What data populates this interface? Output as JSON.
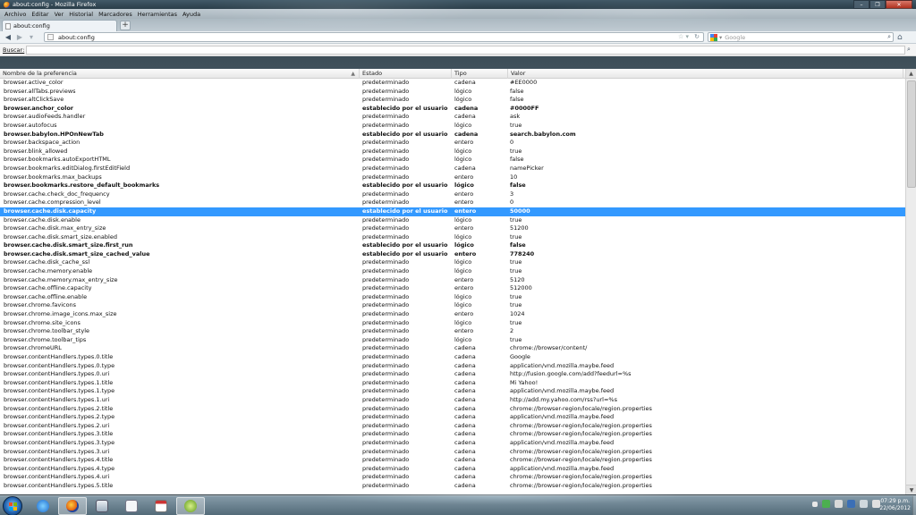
{
  "window": {
    "title": "about:config - Mozilla Firefox"
  },
  "menu": [
    "Archivo",
    "Editar",
    "Ver",
    "Historial",
    "Marcadores",
    "Herramientas",
    "Ayuda"
  ],
  "tab": {
    "label": "about:config"
  },
  "nav": {
    "url": "about:config",
    "search_placeholder": "Google"
  },
  "filter": {
    "label": "Buscar:",
    "value": ""
  },
  "columns": {
    "name": "Nombre de la preferencia",
    "status": "Estado",
    "type": "Tipo",
    "value": "Valor"
  },
  "rows": [
    {
      "name": "browser.active_color",
      "status": "predeterminado",
      "type": "cadena",
      "value": "#EE0000"
    },
    {
      "name": "browser.allTabs.previews",
      "status": "predeterminado",
      "type": "lógico",
      "value": "false"
    },
    {
      "name": "browser.altClickSave",
      "status": "predeterminado",
      "type": "lógico",
      "value": "false"
    },
    {
      "name": "browser.anchor_color",
      "status": "establecido por el usuario",
      "type": "cadena",
      "value": "#0000FF",
      "bold": true
    },
    {
      "name": "browser.audioFeeds.handler",
      "status": "predeterminado",
      "type": "cadena",
      "value": "ask"
    },
    {
      "name": "browser.autofocus",
      "status": "predeterminado",
      "type": "lógico",
      "value": "true"
    },
    {
      "name": "browser.babylon.HPOnNewTab",
      "status": "establecido por el usuario",
      "type": "cadena",
      "value": "search.babylon.com",
      "bold": true
    },
    {
      "name": "browser.backspace_action",
      "status": "predeterminado",
      "type": "entero",
      "value": "0"
    },
    {
      "name": "browser.blink_allowed",
      "status": "predeterminado",
      "type": "lógico",
      "value": "true"
    },
    {
      "name": "browser.bookmarks.autoExportHTML",
      "status": "predeterminado",
      "type": "lógico",
      "value": "false"
    },
    {
      "name": "browser.bookmarks.editDialog.firstEditField",
      "status": "predeterminado",
      "type": "cadena",
      "value": "namePicker"
    },
    {
      "name": "browser.bookmarks.max_backups",
      "status": "predeterminado",
      "type": "entero",
      "value": "10"
    },
    {
      "name": "browser.bookmarks.restore_default_bookmarks",
      "status": "establecido por el usuario",
      "type": "lógico",
      "value": "false",
      "bold": true
    },
    {
      "name": "browser.cache.check_doc_frequency",
      "status": "predeterminado",
      "type": "entero",
      "value": "3"
    },
    {
      "name": "browser.cache.compression_level",
      "status": "predeterminado",
      "type": "entero",
      "value": "0"
    },
    {
      "name": "browser.cache.disk.capacity",
      "status": "establecido por el usuario",
      "type": "entero",
      "value": "50000",
      "bold": true,
      "selected": true
    },
    {
      "name": "browser.cache.disk.enable",
      "status": "predeterminado",
      "type": "lógico",
      "value": "true"
    },
    {
      "name": "browser.cache.disk.max_entry_size",
      "status": "predeterminado",
      "type": "entero",
      "value": "51200"
    },
    {
      "name": "browser.cache.disk.smart_size.enabled",
      "status": "predeterminado",
      "type": "lógico",
      "value": "true"
    },
    {
      "name": "browser.cache.disk.smart_size.first_run",
      "status": "establecido por el usuario",
      "type": "lógico",
      "value": "false",
      "bold": true
    },
    {
      "name": "browser.cache.disk.smart_size_cached_value",
      "status": "establecido por el usuario",
      "type": "entero",
      "value": "778240",
      "bold": true
    },
    {
      "name": "browser.cache.disk_cache_ssl",
      "status": "predeterminado",
      "type": "lógico",
      "value": "true"
    },
    {
      "name": "browser.cache.memory.enable",
      "status": "predeterminado",
      "type": "lógico",
      "value": "true"
    },
    {
      "name": "browser.cache.memory.max_entry_size",
      "status": "predeterminado",
      "type": "entero",
      "value": "5120"
    },
    {
      "name": "browser.cache.offline.capacity",
      "status": "predeterminado",
      "type": "entero",
      "value": "512000"
    },
    {
      "name": "browser.cache.offline.enable",
      "status": "predeterminado",
      "type": "lógico",
      "value": "true"
    },
    {
      "name": "browser.chrome.favicons",
      "status": "predeterminado",
      "type": "lógico",
      "value": "true"
    },
    {
      "name": "browser.chrome.image_icons.max_size",
      "status": "predeterminado",
      "type": "entero",
      "value": "1024"
    },
    {
      "name": "browser.chrome.site_icons",
      "status": "predeterminado",
      "type": "lógico",
      "value": "true"
    },
    {
      "name": "browser.chrome.toolbar_style",
      "status": "predeterminado",
      "type": "entero",
      "value": "2"
    },
    {
      "name": "browser.chrome.toolbar_tips",
      "status": "predeterminado",
      "type": "lógico",
      "value": "true"
    },
    {
      "name": "browser.chromeURL",
      "status": "predeterminado",
      "type": "cadena",
      "value": "chrome://browser/content/"
    },
    {
      "name": "browser.contentHandlers.types.0.title",
      "status": "predeterminado",
      "type": "cadena",
      "value": "Google"
    },
    {
      "name": "browser.contentHandlers.types.0.type",
      "status": "predeterminado",
      "type": "cadena",
      "value": "application/vnd.mozilla.maybe.feed"
    },
    {
      "name": "browser.contentHandlers.types.0.uri",
      "status": "predeterminado",
      "type": "cadena",
      "value": "http://fusion.google.com/add?feedurl=%s"
    },
    {
      "name": "browser.contentHandlers.types.1.title",
      "status": "predeterminado",
      "type": "cadena",
      "value": "Mi Yahoo!"
    },
    {
      "name": "browser.contentHandlers.types.1.type",
      "status": "predeterminado",
      "type": "cadena",
      "value": "application/vnd.mozilla.maybe.feed"
    },
    {
      "name": "browser.contentHandlers.types.1.uri",
      "status": "predeterminado",
      "type": "cadena",
      "value": "http://add.my.yahoo.com/rss?url=%s"
    },
    {
      "name": "browser.contentHandlers.types.2.title",
      "status": "predeterminado",
      "type": "cadena",
      "value": "chrome://browser-region/locale/region.properties"
    },
    {
      "name": "browser.contentHandlers.types.2.type",
      "status": "predeterminado",
      "type": "cadena",
      "value": "application/vnd.mozilla.maybe.feed"
    },
    {
      "name": "browser.contentHandlers.types.2.uri",
      "status": "predeterminado",
      "type": "cadena",
      "value": "chrome://browser-region/locale/region.properties"
    },
    {
      "name": "browser.contentHandlers.types.3.title",
      "status": "predeterminado",
      "type": "cadena",
      "value": "chrome://browser-region/locale/region.properties"
    },
    {
      "name": "browser.contentHandlers.types.3.type",
      "status": "predeterminado",
      "type": "cadena",
      "value": "application/vnd.mozilla.maybe.feed"
    },
    {
      "name": "browser.contentHandlers.types.3.uri",
      "status": "predeterminado",
      "type": "cadena",
      "value": "chrome://browser-region/locale/region.properties"
    },
    {
      "name": "browser.contentHandlers.types.4.title",
      "status": "predeterminado",
      "type": "cadena",
      "value": "chrome://browser-region/locale/region.properties"
    },
    {
      "name": "browser.contentHandlers.types.4.type",
      "status": "predeterminado",
      "type": "cadena",
      "value": "application/vnd.mozilla.maybe.feed"
    },
    {
      "name": "browser.contentHandlers.types.4.uri",
      "status": "predeterminado",
      "type": "cadena",
      "value": "chrome://browser-region/locale/region.properties"
    },
    {
      "name": "browser.contentHandlers.types.5.title",
      "status": "predeterminado",
      "type": "cadena",
      "value": "chrome://browser-region/locale/region.properties"
    }
  ],
  "taskbar": {
    "clock_time": "07:29 p.m.",
    "clock_date": "22/06/2012",
    "apps": [
      "internet-explorer",
      "firefox",
      "windows-explorer",
      "notepad",
      "calendar",
      "app-q"
    ]
  },
  "colors": {
    "selection": "#3399ff",
    "header_bg": "#e8e8e8"
  }
}
